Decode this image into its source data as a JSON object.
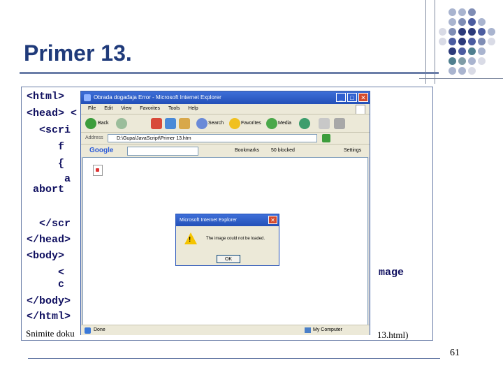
{
  "slide": {
    "title": "Primer 13.",
    "page_number": "61",
    "footer_left": "Snimite doku",
    "footer_right": "13.html)"
  },
  "code": {
    "line_html": "<html>",
    "line_head": "<head> <",
    "line_scri": "  <scri",
    "line_f": "     f",
    "line_brace": "     {",
    "line_a": "      a",
    "line_abort": " abort",
    "line_endscr": "  </scr",
    "line_endhead": "</head>",
    "line_body": "<body>",
    "line_lt": "     <",
    "line_image": "mage",
    "line_c": "     c",
    "line_endbody": "</body>",
    "line_endhtml": "</html>"
  },
  "browser": {
    "title": "Obrada događaja Error - Microsoft Internet Explorer",
    "menu": [
      "File",
      "Edit",
      "View",
      "Favorites",
      "Tools",
      "Help"
    ],
    "toolbar": {
      "back": "Back",
      "search": "Search",
      "favorites": "Favorites",
      "media": "Media"
    },
    "address_label": "Address",
    "address_value": "D:\\Gupa\\JavaScript\\Primer 13.htm",
    "google": {
      "logo": "Google",
      "bookmarks": "Bookmarks",
      "blocked": "50 blocked",
      "settings": "Settings"
    },
    "status_left": "Done",
    "status_right": "My Computer"
  },
  "dialog": {
    "title": "Microsoft Internet Explorer",
    "message": "The image could not be loaded.",
    "ok_label": "OK"
  },
  "colors": {
    "title": "#1f3a7a",
    "code": "#101060",
    "ie_titlebar": "#2350b8"
  }
}
